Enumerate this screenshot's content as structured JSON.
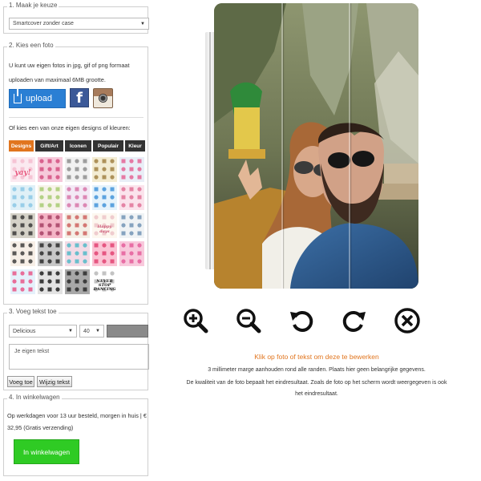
{
  "step1": {
    "legend": "1. Maak je keuze",
    "select_value": "Smartcover zonder case"
  },
  "step2": {
    "legend": "2. Kies een foto",
    "intro": "U kunt uw eigen fotos in jpg, gif of png formaat uploaden van maximaal 6MB grootte.",
    "upload_label": "upload",
    "facebook_letter": "f",
    "or_text": "Of kies een van onze eigen designs of kleuren:",
    "tabs": [
      {
        "label": "Designs",
        "active": true
      },
      {
        "label": "Gift/Art",
        "active": false
      },
      {
        "label": "Iconen",
        "active": false
      },
      {
        "label": "Populair",
        "active": false
      },
      {
        "label": "Kleur",
        "active": false
      }
    ],
    "designs": [
      {
        "label": "yay!",
        "bg": "#fbe9f0",
        "fg": "#e8577e"
      },
      {
        "label": "",
        "bg": "#f6c9da",
        "fg": "#d2487a"
      },
      {
        "label": "",
        "bg": "#f1f1f1",
        "fg": "#888888"
      },
      {
        "label": "",
        "bg": "#f3ecd3",
        "fg": "#9c7c3c"
      },
      {
        "label": "",
        "bg": "#e9eef7",
        "fg": "#e45b8e"
      },
      {
        "label": "",
        "bg": "#dff0f7",
        "fg": "#86c6e4"
      },
      {
        "label": "",
        "bg": "#f7f3e9",
        "fg": "#a2c86c"
      },
      {
        "label": "",
        "bg": "#f3e9f5",
        "fg": "#d66fa5"
      },
      {
        "label": "",
        "bg": "#e6f3fb",
        "fg": "#3a8fd8"
      },
      {
        "label": "",
        "bg": "#fbe3ec",
        "fg": "#e06b94"
      },
      {
        "label": "",
        "bg": "#d5d2c8",
        "fg": "#2f2f2f"
      },
      {
        "label": "",
        "bg": "#f4b4c6",
        "fg": "#a13a5e"
      },
      {
        "label": "",
        "bg": "#f4efe6",
        "fg": "#cc5a58"
      },
      {
        "label": "Happy days",
        "bg": "#fdf7ef",
        "fg": "#c94d6d"
      },
      {
        "label": "",
        "bg": "#f0f3f5",
        "fg": "#6b8fb2"
      },
      {
        "label": "",
        "bg": "#f7efe7",
        "fg": "#333333"
      },
      {
        "label": "",
        "bg": "#c7c7c7",
        "fg": "#222222"
      },
      {
        "label": "",
        "bg": "#f3dbe6",
        "fg": "#47b8c7"
      },
      {
        "label": "",
        "bg": "#fbc3d4",
        "fg": "#e13b6c"
      },
      {
        "label": "",
        "bg": "#f8c9dc",
        "fg": "#e45797"
      },
      {
        "label": "",
        "bg": "#e5f1fb",
        "fg": "#e94e82"
      },
      {
        "label": "",
        "bg": "#e3e3e3",
        "fg": "#111111"
      },
      {
        "label": "",
        "bg": "#a8a8a8",
        "fg": "#222222"
      },
      {
        "label": "NEVER STOP DANCING",
        "bg": "#ffffff",
        "fg": "#111111"
      }
    ]
  },
  "step3": {
    "legend": "3. Voeg tekst toe",
    "font_value": "Delicious",
    "size_value": "40",
    "text_placeholder": "Je eigen tekst",
    "add_button": "Voeg toe",
    "edit_button": "Wijzig tekst",
    "swatch_color": "#8a8a8a"
  },
  "step4": {
    "legend": "4. In winkelwagen",
    "text": "Op werkdagen voor 13 uur besteld, morgen in huis | € 32,95 (Gratis verzending)",
    "cart_button": "In winkelwagen"
  },
  "controls": [
    {
      "name": "zoom-in-icon"
    },
    {
      "name": "zoom-out-icon"
    },
    {
      "name": "rotate-left-icon"
    },
    {
      "name": "rotate-right-icon"
    },
    {
      "name": "delete-icon"
    }
  ],
  "info": {
    "click_hint": "Klik op foto of tekst om deze te bewerken",
    "margin_note": "3 millimeter marge aanhouden rond alle randen. Plaats hier geen belangrijke gegevens.",
    "quality_note_1": "De kwaliteit van de foto bepaalt het eindresultaat. Zoals de foto op het scherm wordt weergegeven is ook",
    "quality_note_2": "het eindresultaat."
  },
  "colors": {
    "accent": "#e1751e",
    "upload": "#2a7fd4",
    "cart": "#2fcb24",
    "icon": "#111111"
  }
}
